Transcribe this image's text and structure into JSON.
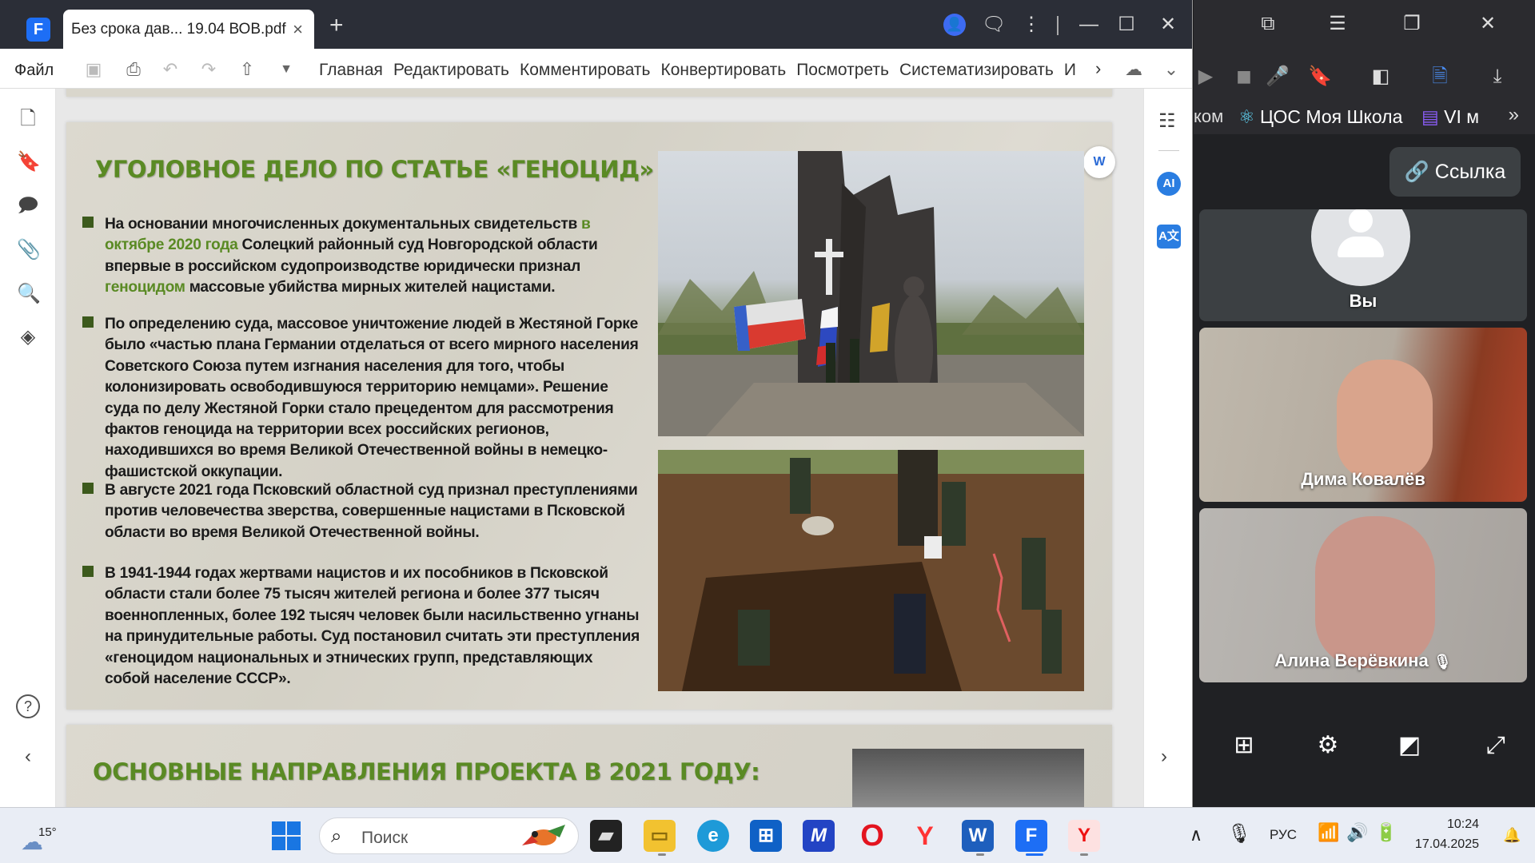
{
  "pdf_app": {
    "tab_title": "Без срока дав... 19.04 ВОВ.pdf",
    "tab_close": "×",
    "new_tab": "+",
    "menu_file": "Файл",
    "menu_tabs": [
      "Главная",
      "Редактировать",
      "Комментировать",
      "Конвертировать",
      "Посмотреть",
      "Систематизировать",
      "И"
    ],
    "right_rail": {
      "ai_label": "AI",
      "translate_label": "A文"
    },
    "convert_word_label": "W"
  },
  "slide": {
    "title": "УГОЛОВНОЕ ДЕЛО ПО СТАТЬЕ «ГЕНОЦИД»",
    "bullets": [
      {
        "parts": [
          {
            "text": "На основании многочисленных документальных свидетельств ",
            "hl": false
          },
          {
            "text": "в октябре 2020 года",
            "hl": true
          },
          {
            "text": " Солецкий районный суд Новгородской области впервые в российском судопроизводстве юридически признал ",
            "hl": false
          },
          {
            "text": "геноцидом",
            "hl": true
          },
          {
            "text": " массовые убийства мирных жителей нацистами.",
            "hl": false
          }
        ]
      },
      {
        "parts": [
          {
            "text": "По определению суда, массовое уничтожение людей в Жестяной Горке было «частью плана Германии отделаться от всего мирного населения Советского Союза путем изгнания населения для того, чтобы колонизировать освободившуюся территорию немцами». Решение суда по делу Жестяной Горки стало прецедентом для рассмотрения фактов геноцида на территории всех российских регионов, находившихся во время Великой Отечественной войны в немецко-фашистской оккупации.",
            "hl": false
          }
        ]
      },
      {
        "parts": [
          {
            "text": "В августе 2021 года Псковский областной суд признал преступлениями против человечества зверства, совершенные нацистами в Псковской области во время Великой Отечественной войны.",
            "hl": false
          }
        ]
      },
      {
        "parts": [
          {
            "text": "В 1941-1944 годах жертвами нацистов и их пособников в Псковской области стали более 75 тысяч жителей региона и более 377 тысяч военнопленных, более 192 тысяч человек были насильственно угнаны на принудительные работы. Суд постановил считать эти преступления «геноцидом национальных и этнических групп, представляющих собой население СССР».",
            "hl": false
          }
        ]
      }
    ],
    "next_title": "ОСНОВНЫЕ НАПРАВЛЕНИЯ ПРОЕКТА В 2021 ГОДУ:"
  },
  "call": {
    "bookmarks": [
      "ком",
      "ЦОС Моя Школа",
      "VI м"
    ],
    "link_button": "Ссылка",
    "participants": [
      {
        "name": "Вы"
      },
      {
        "name": "Дима Ковалёв"
      },
      {
        "name": "Алина Верёвкина"
      }
    ]
  },
  "taskbar": {
    "weather_temp": "15°",
    "search_placeholder": "Поиск",
    "language": "РУС",
    "time": "10:24",
    "date": "17.04.2025"
  },
  "colors": {
    "slide_title_green": "#5a8a24",
    "bullet_green": "#3c5a1c",
    "pdf_accent": "#1d6ef5",
    "call_bg": "#202124"
  }
}
